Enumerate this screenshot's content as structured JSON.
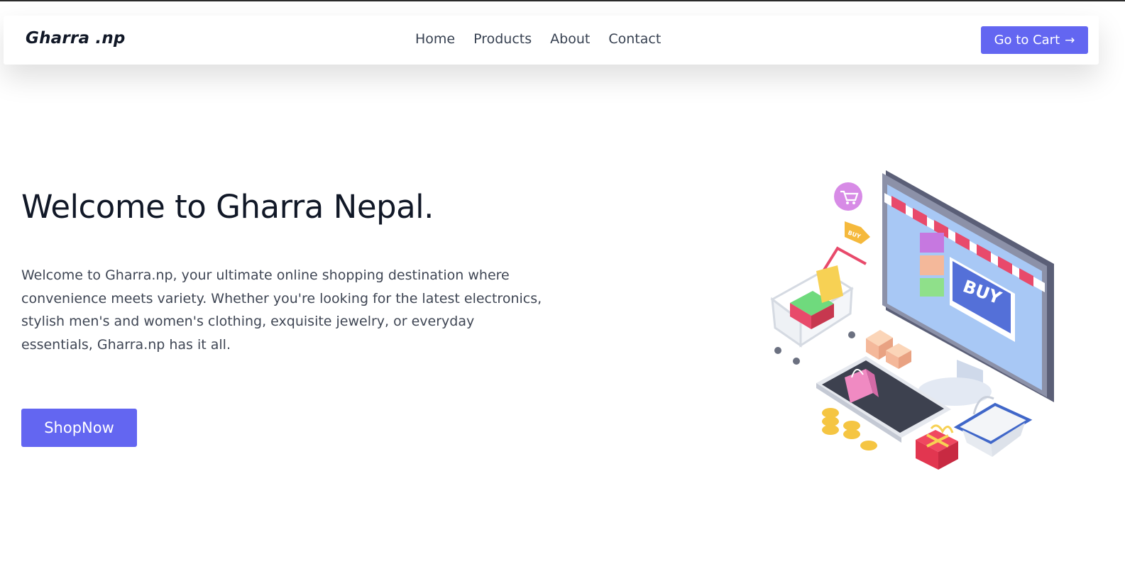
{
  "nav": {
    "logo": "Gharra .np",
    "links": [
      {
        "label": "Home"
      },
      {
        "label": "Products"
      },
      {
        "label": "About"
      },
      {
        "label": "Contact"
      }
    ],
    "cart_button": "Go to Cart"
  },
  "hero": {
    "title": "Welcome to Gharra Nepal.",
    "description": "Welcome to Gharra.np, your ultimate online shopping destination where convenience meets variety. Whether you're looking for the latest electronics, stylish men's and women's clothing, exquisite jewelry, or everyday essentials, Gharra.np has it all.",
    "cta_button": "ShopNow",
    "illustration": {
      "buy_label": "BUY",
      "tag_label": "BUY"
    }
  },
  "colors": {
    "accent": "#6366f1",
    "text_dark": "#111827",
    "text_body": "#3f4654"
  },
  "icons": {
    "cart_arrow": "arrow-right-icon"
  }
}
